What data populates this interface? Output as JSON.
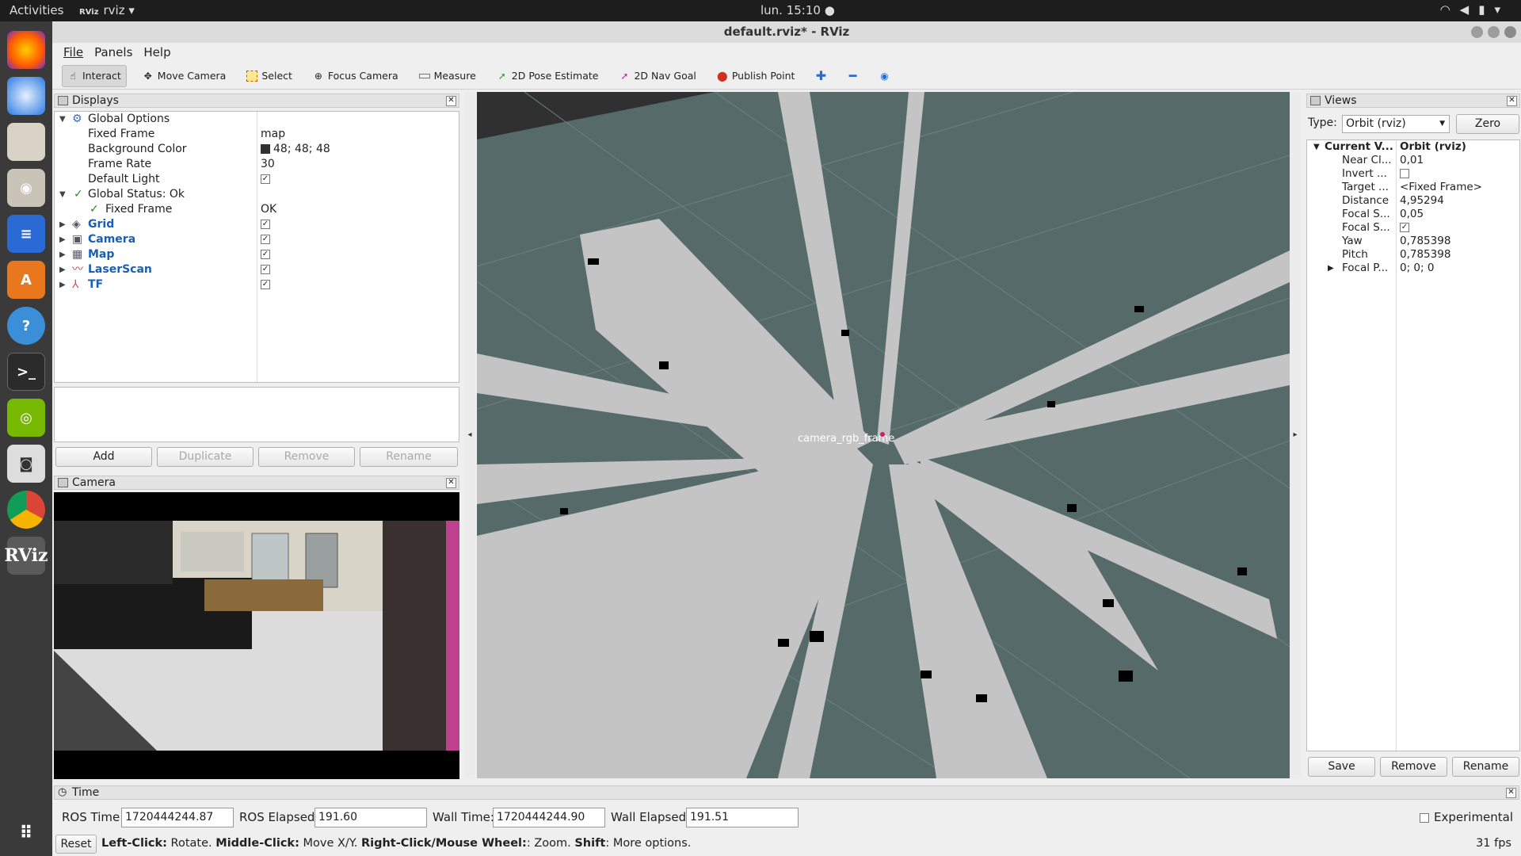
{
  "topbar": {
    "activities": "Activities",
    "app_logo": "RViz",
    "app_name": "rviz ▾",
    "clock": "lun. 15:10 ●"
  },
  "window": {
    "title": "default.rviz* - RViz"
  },
  "menu": [
    "File",
    "Panels",
    "Help"
  ],
  "toolbar": {
    "interact": "Interact",
    "move_camera": "Move Camera",
    "select": "Select",
    "focus_camera": "Focus Camera",
    "measure": "Measure",
    "pose_estimate": "2D Pose Estimate",
    "nav_goal": "2D Nav Goal",
    "publish_point": "Publish Point"
  },
  "displays": {
    "title": "Displays",
    "global_options": "Global Options",
    "fixed_frame_label": "Fixed Frame",
    "fixed_frame_value": "map",
    "bg_color_label": "Background Color",
    "bg_color_value": "48; 48; 48",
    "frame_rate_label": "Frame Rate",
    "frame_rate_value": "30",
    "default_light_label": "Default Light",
    "global_status": "Global Status: Ok",
    "status_fixed_frame": "Fixed Frame",
    "status_fixed_frame_value": "OK",
    "items": [
      {
        "label": "Grid"
      },
      {
        "label": "Camera"
      },
      {
        "label": "Map"
      },
      {
        "label": "LaserScan"
      },
      {
        "label": "TF"
      }
    ],
    "buttons": {
      "add": "Add",
      "duplicate": "Duplicate",
      "remove": "Remove",
      "rename": "Rename"
    }
  },
  "camera_panel": {
    "title": "Camera"
  },
  "viewport": {
    "frame_labels": "camera_rgb_frame"
  },
  "views": {
    "title": "Views",
    "type_label": "Type:",
    "type_value": "Orbit (rviz)",
    "zero": "Zero",
    "current_view": "Current V...",
    "current_view_value": "Orbit (rviz)",
    "props": [
      {
        "k": "Near Cl...",
        "v": "0,01"
      },
      {
        "k": "Invert ...",
        "v": ""
      },
      {
        "k": "Target ...",
        "v": "<Fixed Frame>"
      },
      {
        "k": "Distance",
        "v": "4,95294"
      },
      {
        "k": "Focal S...",
        "v": "0,05"
      },
      {
        "k": "Focal S...",
        "v": ""
      },
      {
        "k": "Yaw",
        "v": "0,785398"
      },
      {
        "k": "Pitch",
        "v": "0,785398"
      },
      {
        "k": "Focal P...",
        "v": "0; 0; 0"
      }
    ],
    "save": "Save",
    "remove": "Remove",
    "rename": "Rename"
  },
  "time": {
    "title": "Time",
    "ros_time_label": "ROS Time:",
    "ros_time": "1720444244.87",
    "ros_elapsed_label": "ROS Elapsed:",
    "ros_elapsed": "191.60",
    "wall_time_label": "Wall Time:",
    "wall_time": "1720444244.90",
    "wall_elapsed_label": "Wall Elapsed:",
    "wall_elapsed": "191.51",
    "experimental": "Experimental"
  },
  "status": {
    "reset": "Reset",
    "hint_b1": "Left-Click:",
    "hint_t1": " Rotate. ",
    "hint_b2": "Middle-Click:",
    "hint_t2": " Move X/Y. ",
    "hint_b3": "Right-Click/Mouse Wheel:",
    "hint_t3": ": Zoom. ",
    "hint_b4": "Shift",
    "hint_t4": ": More options.",
    "fps": "31 fps"
  },
  "colors": {
    "viewport_bg": "#566a6a",
    "map_free": "#c4c4c4",
    "map_occupied": "#000000"
  }
}
